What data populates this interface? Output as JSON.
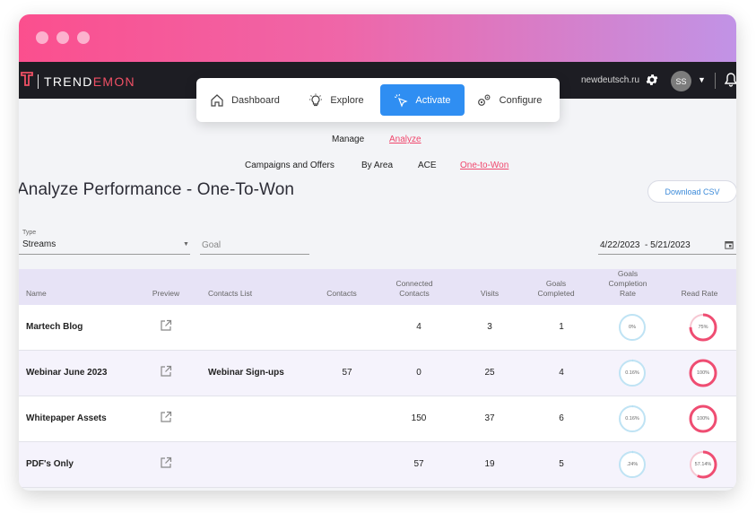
{
  "app": {
    "logo_text_pre": "TREND",
    "logo_text_hl": "EMON",
    "domain": "newdeutsch.ru",
    "avatar_initials": "SS"
  },
  "nav": [
    {
      "label": "Dashboard",
      "icon": "home-icon",
      "active": false
    },
    {
      "label": "Explore",
      "icon": "lightbulb-icon",
      "active": false
    },
    {
      "label": "Activate",
      "icon": "cursor-click-icon",
      "active": true
    },
    {
      "label": "Configure",
      "icon": "gears-icon",
      "active": false
    }
  ],
  "subtabs": {
    "manage": "Manage",
    "analyze": "Analyze"
  },
  "reporttabs": {
    "campaigns": "Campaigns and Offers",
    "by_area": "By Area",
    "ace": "ACE",
    "one_to_won": "One-to-Won"
  },
  "page": {
    "title": "Analyze Performance - One-To-Won",
    "download_label": "Download CSV"
  },
  "filters": {
    "type_label": "Type",
    "type_value": "Streams",
    "goal_placeholder": "Goal",
    "date_range": "4/22/2023  - 5/21/2023"
  },
  "table": {
    "headers": {
      "name": "Name",
      "preview": "Preview",
      "contacts_list": "Contacts List",
      "contacts": "Contacts",
      "connected_contacts": "Connected Contacts",
      "visits": "Visits",
      "goals_completed": "Goals Completed",
      "goals_completion_rate": "Goals Completion Rate",
      "read_rate": "Read Rate"
    },
    "rows": [
      {
        "name": "Martech Blog",
        "contacts_list": "",
        "contacts": "",
        "connected": "4",
        "visits": "3",
        "goals": "1",
        "goal_rate": "0%",
        "goal_rate_value": 0,
        "read_rate": "75%",
        "read_rate_value": 75
      },
      {
        "name": "Webinar June 2023",
        "contacts_list": "Webinar Sign-ups",
        "contacts": "57",
        "connected": "0",
        "visits": "25",
        "goals": "4",
        "goal_rate": "0.16%",
        "goal_rate_value": 0.16,
        "read_rate": "100%",
        "read_rate_value": 100
      },
      {
        "name": "Whitepaper Assets",
        "contacts_list": "",
        "contacts": "",
        "connected": "150",
        "visits": "37",
        "goals": "6",
        "goal_rate": "0.16%",
        "goal_rate_value": 0.16,
        "read_rate": "100%",
        "read_rate_value": 100
      },
      {
        "name": "PDF's Only",
        "contacts_list": "",
        "contacts": "",
        "connected": "57",
        "visits": "19",
        "goals": "5",
        "goal_rate": ".24%",
        "goal_rate_value": 0.24,
        "read_rate": "57.14%",
        "read_rate_value": 57.14
      }
    ]
  },
  "colors": {
    "accent": "#2f8ef2",
    "brand": "#f05065",
    "read_ring": "#ef4d72",
    "goal_ring": "#bfe3f4"
  }
}
